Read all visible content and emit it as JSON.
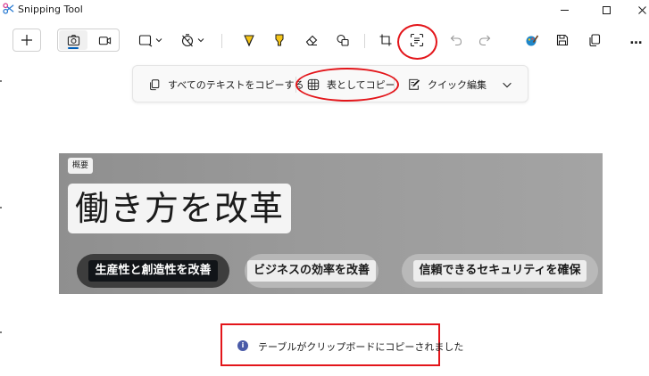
{
  "window": {
    "title": "Snipping Tool",
    "controls": {
      "minimize": "minimize-icon",
      "maximize": "maximize-icon",
      "close": "close-icon"
    }
  },
  "toolbar": {
    "icons": [
      "plus-icon",
      "camera-icon",
      "video-icon",
      "rectangle-snip-icon",
      "delay-timer-icon",
      "ballpoint-pen-icon",
      "highlighter-icon",
      "eraser-icon",
      "shapes-icon",
      "crop-icon",
      "text-actions-icon",
      "undo-icon",
      "redo-icon",
      "paint-icon",
      "save-icon",
      "copy-icon",
      "more-icon"
    ],
    "more_label": "…"
  },
  "text_actions": {
    "copy_all_text": "すべてのテキストをコピーする",
    "copy_as_table": "表としてコピー",
    "quick_edit": "クイック編集"
  },
  "capture": {
    "tag": "概要",
    "headline": "働き方を改革",
    "pills": [
      "生産性と創造性を改善",
      "ビジネスの効率を改善",
      "信頼できるセキュリティを確保"
    ]
  },
  "toast": {
    "message": "テーブルがクリップボードにコピーされました",
    "icon": "info-icon"
  },
  "colors": {
    "accent": "#005fb8",
    "highlight_ring": "#e3151a",
    "pen_yellow": "#f5c518",
    "paint_blue": "#1f86c8"
  }
}
